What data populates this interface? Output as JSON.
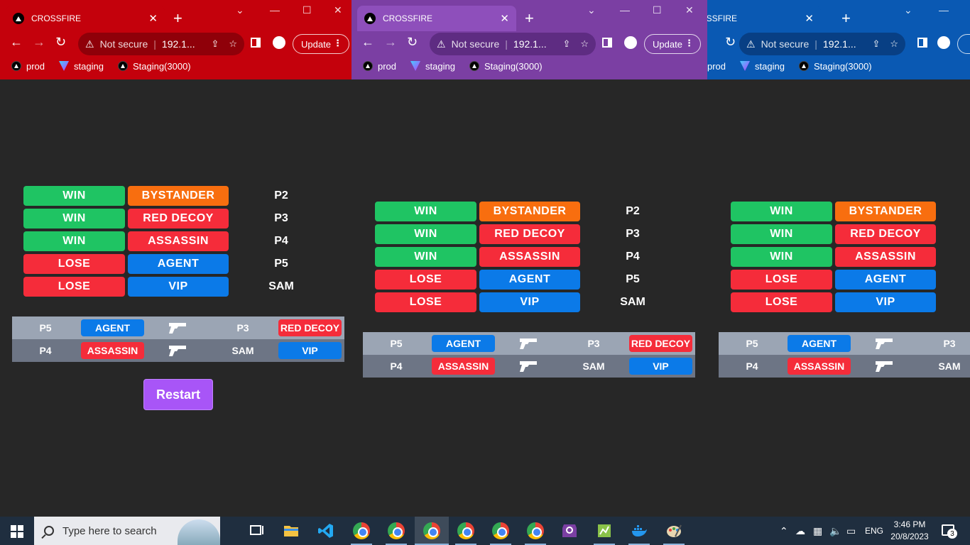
{
  "browser": {
    "tab_title": "CROSSFIRE",
    "new_tab": "+",
    "close": "✕",
    "omnibox_warning": "Not secure",
    "omnibox_url": "192.1...",
    "update_label": "Update",
    "bookmarks": [
      {
        "label": "prod",
        "icon": "vercel-icon"
      },
      {
        "label": "staging",
        "icon": "vite-icon"
      },
      {
        "label": "Staging(3000)",
        "icon": "vercel-icon"
      }
    ],
    "window_colors": [
      "#c4010c",
      "#7b3fa3",
      "#0a59b3"
    ]
  },
  "game": {
    "roles": [
      {
        "result": "WIN",
        "role": "BYSTANDER",
        "player": "P2"
      },
      {
        "result": "WIN",
        "role": "RED DECOY",
        "player": "P3"
      },
      {
        "result": "WIN",
        "role": "ASSASSIN",
        "player": "P4"
      },
      {
        "result": "LOSE",
        "role": "AGENT",
        "player": "P5"
      },
      {
        "result": "LOSE",
        "role": "VIP",
        "player": "SAM"
      }
    ],
    "kills": [
      {
        "killer": "P5",
        "killer_role": "AGENT",
        "victim": "P3",
        "victim_role": "RED DECOY"
      },
      {
        "killer": "P4",
        "killer_role": "ASSASSIN",
        "victim": "SAM",
        "victim_role": "VIP"
      }
    ],
    "restart_label": "Restart",
    "colors": {
      "win": "#1fc463",
      "lose": "#f52c3a",
      "bystander": "#f86e0f",
      "red": "#f52c3a",
      "blue": "#0b7ae8",
      "restart": "#a855f7"
    }
  },
  "taskbar": {
    "search_placeholder": "Type here to search",
    "language": "ENG",
    "time": "3:46 PM",
    "date": "20/8/2023",
    "notification_count": "3"
  }
}
